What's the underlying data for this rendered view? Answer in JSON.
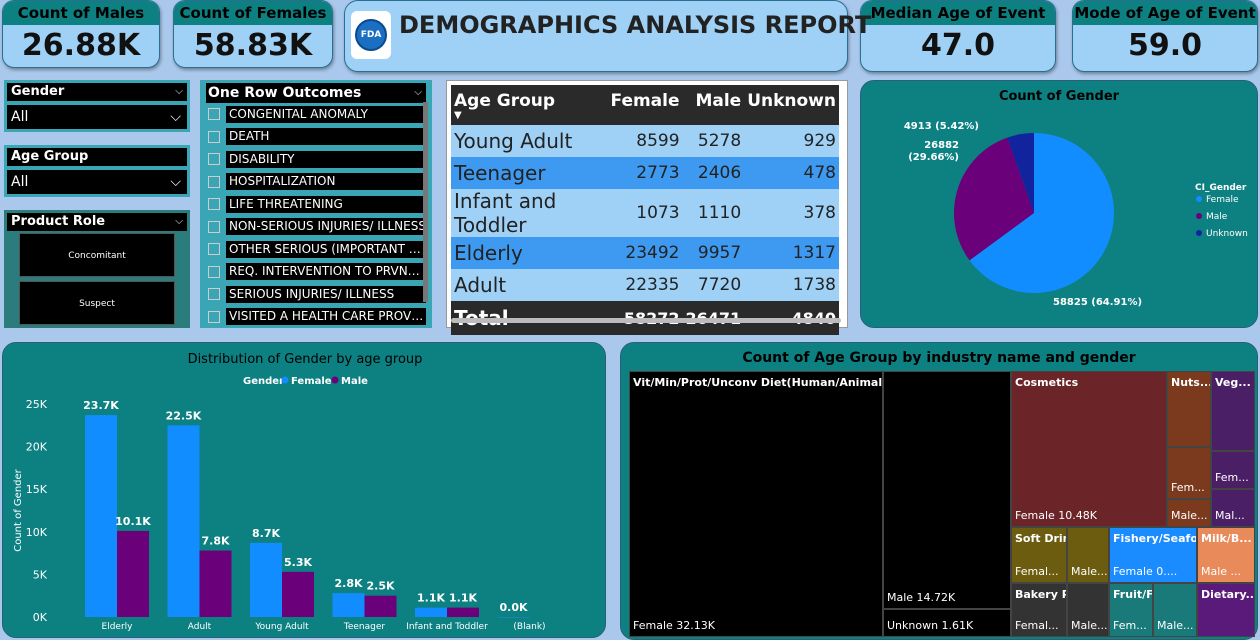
{
  "kpis": [
    {
      "label": "Count of Males",
      "value": "26.88K"
    },
    {
      "label": "Count of Females",
      "value": "58.83K"
    },
    {
      "label": "Median Age of Event",
      "value": "47.0"
    },
    {
      "label": "Mode of Age of Event",
      "value": "59.0"
    }
  ],
  "report": {
    "title": "DEMOGRAPHICS ANALYSIS REPORT",
    "logo_text": "FDA"
  },
  "slicers": {
    "gender": {
      "label": "Gender",
      "value": "All"
    },
    "age_group": {
      "label": "Age Group",
      "value": "All"
    },
    "product_role": {
      "label": "Product Role",
      "options": [
        "Concomitant",
        "Suspect"
      ]
    },
    "outcomes": {
      "label": "One Row Outcomes",
      "items": [
        "CONGENITAL ANOMALY",
        "DEATH",
        "DISABILITY",
        "HOSPITALIZATION",
        "LIFE THREATENING",
        "NON-SERIOUS INJURIES/ ILLNESS",
        "OTHER SERIOUS (IMPORTANT ME...",
        "REQ. INTERVENTION TO PRVNT P...",
        "SERIOUS INJURIES/ ILLNESS",
        "VISITED A HEALTH CARE PROVIDER"
      ]
    }
  },
  "table": {
    "headers": [
      "Age Group",
      "Female",
      "Male",
      "Unknown"
    ],
    "rows": [
      [
        "Young Adult",
        "8599",
        "5278",
        "929"
      ],
      [
        "Teenager",
        "2773",
        "2406",
        "478"
      ],
      [
        "Infant and Toddler",
        "1073",
        "1110",
        "378"
      ],
      [
        "Elderly",
        "23492",
        "9957",
        "1317"
      ],
      [
        "Adult",
        "22335",
        "7720",
        "1738"
      ]
    ],
    "total": [
      "Total",
      "58272",
      "26471",
      "4840"
    ]
  },
  "pie": {
    "title": "Count of Gender",
    "legend_title": "CI_Gender",
    "slices": [
      {
        "name": "Female",
        "value": 58825,
        "label": "58825 (64.91%)",
        "color": "#118dff"
      },
      {
        "name": "Male",
        "value": 26882,
        "label": "26882 (29.66%)",
        "color": "#6b007b"
      },
      {
        "name": "Unknown",
        "value": 4913,
        "label": "4913 (5.42%)",
        "color": "#12239e"
      }
    ]
  },
  "chart_data": {
    "type": "bar",
    "title": "Distribution of Gender by age group",
    "legend_title": "Gender",
    "legend_position": "top",
    "ylabel": "Count of Gender",
    "ylim": [
      0,
      25000
    ],
    "yticks": [
      "0K",
      "5K",
      "10K",
      "15K",
      "20K",
      "25K"
    ],
    "ytick_values": [
      0,
      5000,
      10000,
      15000,
      20000,
      25000
    ],
    "categories": [
      "Elderly",
      "Adult",
      "Young Adult",
      "Teenager",
      "Infant and Toddler",
      "(Blank)"
    ],
    "series": [
      {
        "name": "Female",
        "color": "#118dff",
        "values": [
          23700,
          22500,
          8700,
          2800,
          1100,
          0
        ],
        "labels": [
          "23.7K",
          "22.5K",
          "8.7K",
          "2.8K",
          "1.1K",
          "0.0K"
        ]
      },
      {
        "name": "Male",
        "color": "#6b007b",
        "values": [
          10100,
          7800,
          5300,
          2500,
          1100,
          null
        ],
        "labels": [
          "10.1K",
          "7.8K",
          "5.3K",
          "2.5K",
          "1.1K",
          ""
        ]
      }
    ]
  },
  "treemap": {
    "title": "Count of Age Group by industry name and gender",
    "cells": [
      {
        "top": "Vit/Min/Prot/Unconv Diet(Human/Animal)",
        "bottom": "Female 32.13K",
        "color": "#000000"
      },
      {
        "top": "",
        "bottom": "Male 14.72K",
        "color": "#000000"
      },
      {
        "top": "",
        "bottom": "Unknown 1.61K",
        "color": "#000000"
      },
      {
        "top": "Cosmetics",
        "bottom": "Female 10.48K",
        "color": "#6b2428"
      },
      {
        "top": "Nuts...",
        "bottom": "",
        "color": "#7b3a1e"
      },
      {
        "top": "",
        "bottom": "Fem...",
        "color": "#7b3a1e"
      },
      {
        "top": "",
        "bottom": "Male...",
        "color": "#7b3a1e"
      },
      {
        "top": "Veg...",
        "bottom": "",
        "color": "#4a1f66"
      },
      {
        "top": "",
        "bottom": "Fem...",
        "color": "#4a1f66"
      },
      {
        "top": "",
        "bottom": "Mal...",
        "color": "#4a1f66"
      },
      {
        "top": "Soft Drink/Water",
        "bottom": "Femal...",
        "color": "#6b5c0f"
      },
      {
        "top": "",
        "bottom": "Male...",
        "color": "#6b5c0f"
      },
      {
        "top": "Fishery/Seafo...",
        "bottom": "Female 0....",
        "color": "#1a8cff"
      },
      {
        "top": "Milk/B...",
        "bottom": "Male ...",
        "color": "#e88a5a"
      },
      {
        "top": "Bakery Prod/D...",
        "bottom": "Femal...",
        "color": "#333333"
      },
      {
        "top": "",
        "bottom": "Male...",
        "color": "#333333"
      },
      {
        "top": "Fruit/Fruit Prod",
        "bottom": "Fem...",
        "color": "#1a7a7a"
      },
      {
        "top": "",
        "bottom": "Male...",
        "color": "#1a7a7a"
      },
      {
        "top": "Dietary...",
        "bottom": "",
        "color": "#5a1a7a"
      }
    ]
  }
}
